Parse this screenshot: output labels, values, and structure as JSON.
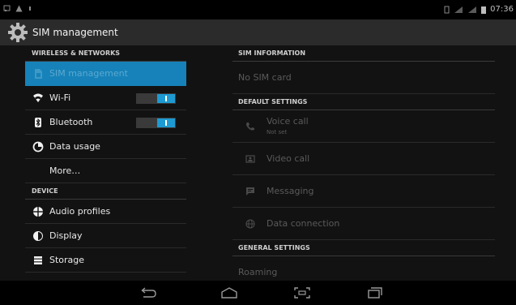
{
  "status": {
    "time": "07:36"
  },
  "app": {
    "title": "SIM management"
  },
  "left": {
    "section_wireless": "WIRELESS & NETWORKS",
    "section_device": "DEVICE",
    "items": [
      {
        "label": "SIM management",
        "icon": "sim-icon"
      },
      {
        "label": "Wi-Fi",
        "icon": "wifi-icon",
        "toggle": "on"
      },
      {
        "label": "Bluetooth",
        "icon": "bluetooth-icon",
        "toggle": "on"
      },
      {
        "label": "Data usage",
        "icon": "data-usage-icon"
      },
      {
        "label": "More…",
        "icon": ""
      },
      {
        "label": "Audio profiles",
        "icon": "audio-profiles-icon"
      },
      {
        "label": "Display",
        "icon": "display-icon"
      },
      {
        "label": "Storage",
        "icon": "storage-icon"
      }
    ]
  },
  "right": {
    "section_sim_info": "SIM INFORMATION",
    "no_sim": "No SIM card",
    "section_default": "DEFAULT SETTINGS",
    "items": [
      {
        "label": "Voice call",
        "sub": "Not set",
        "icon": "phone-icon"
      },
      {
        "label": "Video call",
        "icon": "video-call-icon"
      },
      {
        "label": "Messaging",
        "icon": "messaging-icon"
      },
      {
        "label": "Data connection",
        "icon": "globe-icon"
      }
    ],
    "section_general": "GENERAL SETTINGS",
    "roaming": "Roaming"
  },
  "colors": {
    "accent": "#1682b9",
    "toggle_on": "#1d9ad2"
  }
}
